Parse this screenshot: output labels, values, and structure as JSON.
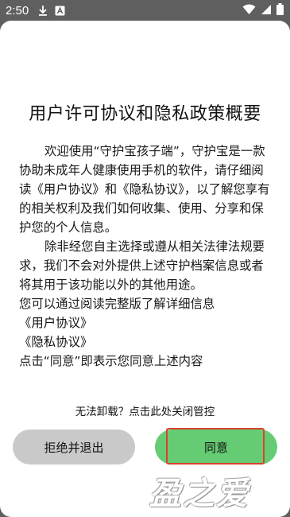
{
  "status_bar": {
    "time": "2:50",
    "left_icons": [
      "download-icon",
      "app-notification-icon"
    ],
    "right_icons": [
      "wifi-icon",
      "signal-icon",
      "battery-icon"
    ]
  },
  "dialog": {
    "title": "用户许可协议和隐私政策概要",
    "intro_before": "欢迎使用“守护宝孩子端”，守护宝是一款协助未成年人健康使用手机的软件，请仔细阅读",
    "user_agreement_link": "《用户协议》",
    "intro_and": "和",
    "privacy_policy_link": "《隐私协议》",
    "intro_after": "，以了解您享有的相关权利及我们如何收集、使用、分享和保护您的个人信息。",
    "paragraph2": "除非经您自主选择或遵从相关法律法规要求，我们不会对外提供上述守护档案信息或者将其用于该功能以外的其他用途。",
    "paragraph3": "您可以通过阅读完整版了解详细信息",
    "link_user_agreement": "《用户协议》",
    "link_privacy_policy": "《隐私协议》",
    "consent_note": "点击“同意”即表示您同意上述内容",
    "uninstall_hint": "无法卸载？点击此处关闭管控",
    "reject_button": "拒绝并退出",
    "agree_button": "同意"
  },
  "watermark": "盈之爱",
  "colors": {
    "agree_button": "#66cc73",
    "reject_button": "#c9c9c9",
    "highlight_box": "#d9412e"
  }
}
